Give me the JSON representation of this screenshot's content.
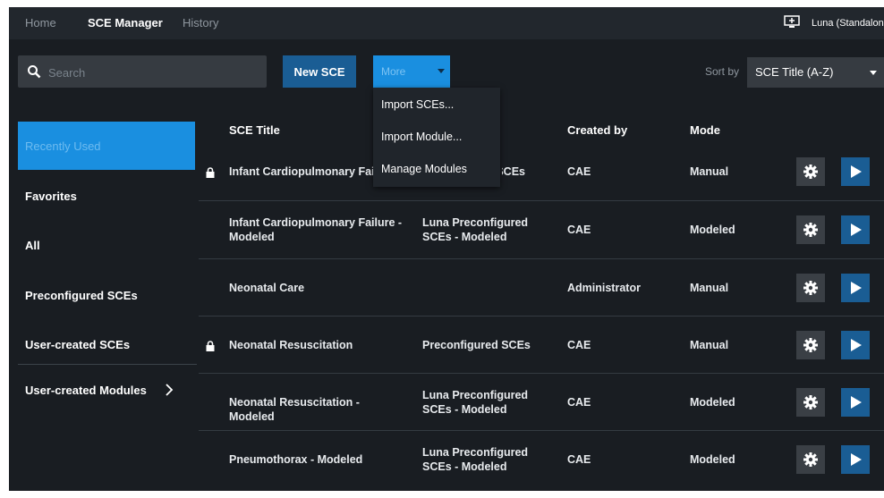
{
  "nav": {
    "home": "Home",
    "sce_manager": "SCE Manager",
    "history": "History",
    "user": "Luna (Standalone"
  },
  "toolbar": {
    "search_placeholder": "Search",
    "new_sce": "New SCE",
    "more": "More",
    "sort_label": "Sort by",
    "sort_value": "SCE Title (A-Z)"
  },
  "more_menu": {
    "items": [
      "Import SCEs...",
      "Import Module...",
      "Manage Modules"
    ]
  },
  "sidebar": {
    "items": [
      "Recently Used",
      "Favorites",
      "All",
      "Preconfigured SCEs",
      "User-created SCEs",
      "User-created Modules"
    ]
  },
  "table": {
    "headers": {
      "title": "SCE Title",
      "created_by": "Created by",
      "mode": "Mode"
    },
    "rows": [
      {
        "title": "Infant Cardiopulmonary Failure",
        "category": "Preconfigured SCEs",
        "created_by": "CAE",
        "mode": "Manual",
        "locked": true
      },
      {
        "title": "Infant Cardiopulmonary Failure - Modeled",
        "category": "Luna Preconfigured SCEs - Modeled",
        "created_by": "CAE",
        "mode": "Modeled",
        "locked": false
      },
      {
        "title": "Neonatal Care",
        "category": "",
        "created_by": "Administrator",
        "mode": "Manual",
        "locked": false
      },
      {
        "title": "Neonatal Resuscitation",
        "category": "Preconfigured SCEs",
        "created_by": "CAE",
        "mode": "Manual",
        "locked": true
      },
      {
        "title": "Neonatal Resuscitation - Modeled",
        "category": "Luna Preconfigured SCEs - Modeled",
        "created_by": "CAE",
        "mode": "Modeled",
        "locked": false
      },
      {
        "title": "Pneumothorax - Modeled",
        "category": "Luna Preconfigured SCEs - Modeled",
        "created_by": "CAE",
        "mode": "Modeled",
        "locked": false
      }
    ]
  },
  "colors": {
    "background": "#191d22",
    "topbar": "#22272d",
    "accent": "#1a8fe0",
    "button_dark_blue": "#1a5d94"
  },
  "icons": {
    "monitor": "monitor-icon",
    "search": "search-icon",
    "lock": "lock-icon",
    "gear": "gear-icon",
    "play": "play-icon",
    "chevron": "chevron-right-icon"
  }
}
